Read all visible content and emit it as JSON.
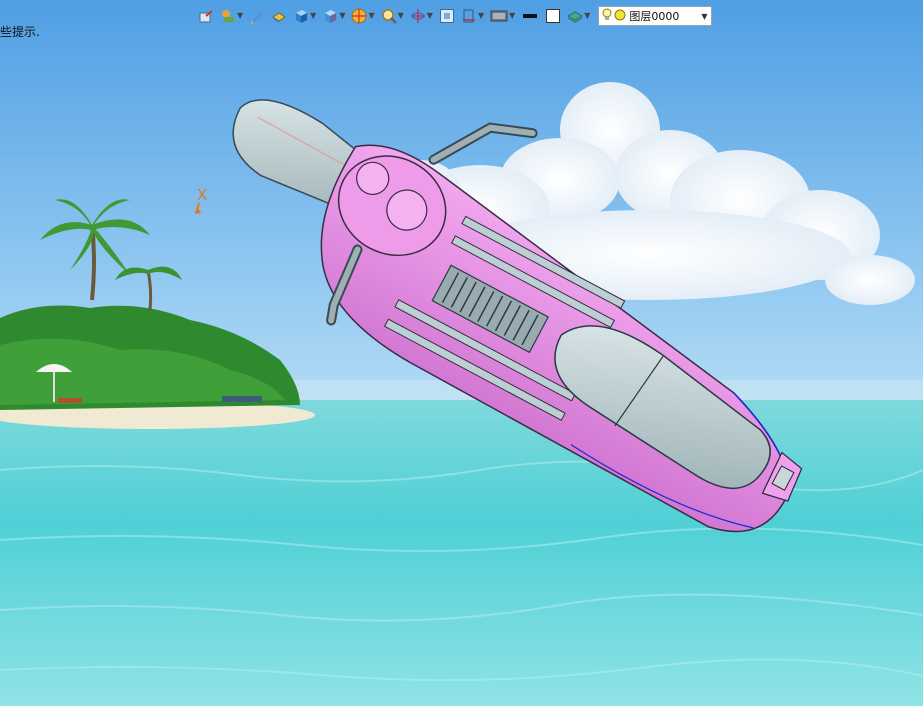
{
  "hint": {
    "text": "些提示."
  },
  "toolbar": {
    "tools": [
      {
        "name": "undo-icon",
        "dropdown": false
      },
      {
        "name": "measure-icon",
        "dropdown": true
      },
      {
        "name": "pencil-icon",
        "dropdown": false
      },
      {
        "name": "surface-icon",
        "dropdown": false
      },
      {
        "name": "solid-box-icon",
        "dropdown": true
      },
      {
        "name": "view-cube-icon",
        "dropdown": true
      },
      {
        "name": "render-sphere-icon",
        "dropdown": true
      },
      {
        "name": "zoom-icon",
        "dropdown": true
      },
      {
        "name": "rotate-axis-icon",
        "dropdown": true
      },
      {
        "name": "fit-view-icon",
        "dropdown": false
      },
      {
        "name": "section-icon",
        "dropdown": true
      },
      {
        "name": "display-mode-icon",
        "dropdown": true
      },
      {
        "name": "line-weight-icon",
        "dropdown": false
      },
      {
        "name": "color-square-icon",
        "dropdown": false
      },
      {
        "name": "layer-stack-icon",
        "dropdown": true
      }
    ],
    "layer": {
      "name": "图层0000"
    }
  },
  "triad": {
    "x_label": "X"
  },
  "colors": {
    "sky_top": "#5aa6e6",
    "sky_bottom": "#a9d6f4",
    "sea": "#5fd3d8",
    "body_pink": "#e98ee6",
    "metal_gray": "#b7c9cc",
    "axis_orange": "#e07820"
  }
}
